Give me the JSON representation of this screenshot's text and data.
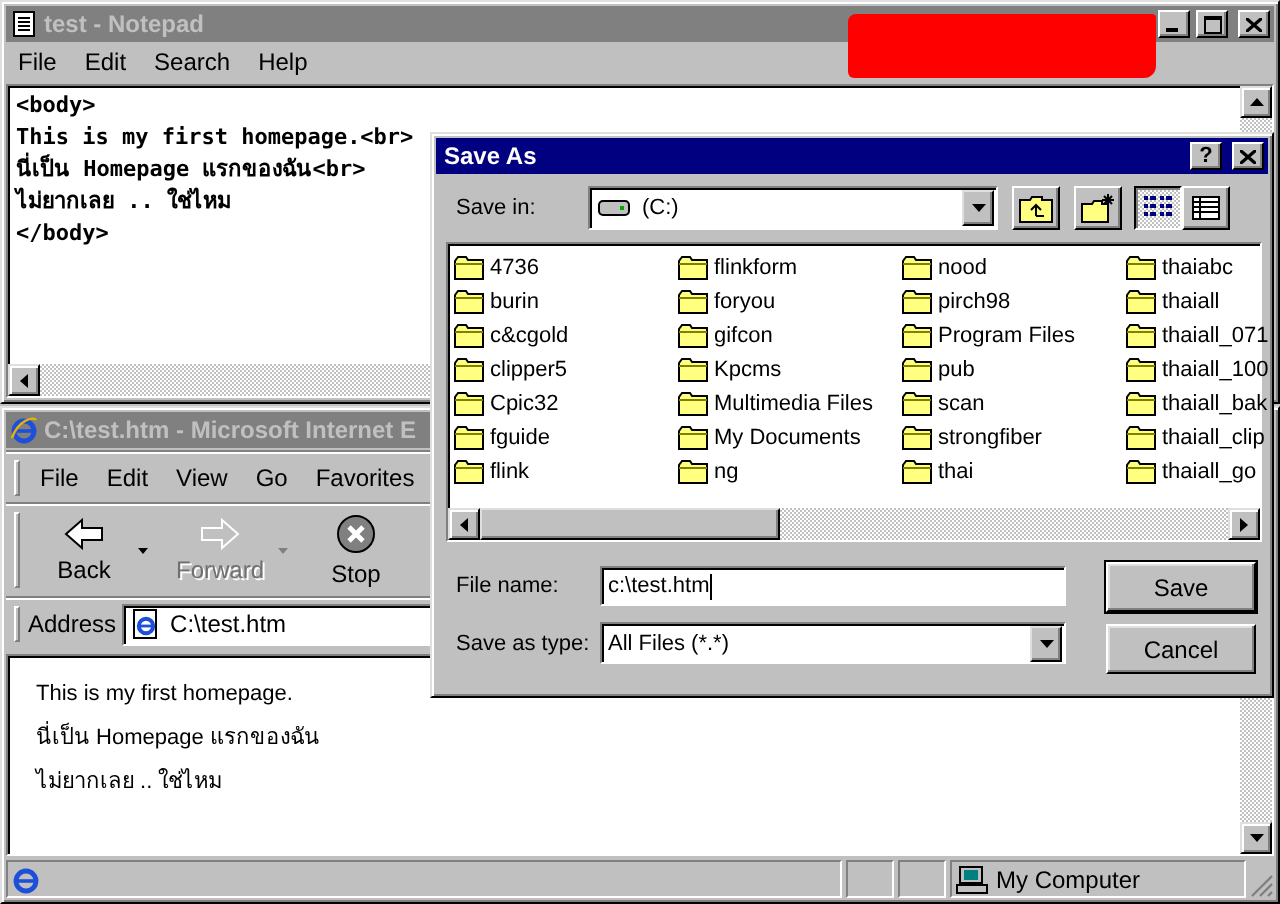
{
  "notepad": {
    "title": "test - Notepad",
    "active": false,
    "menu": [
      "File",
      "Edit",
      "Search",
      "Help"
    ],
    "lines": [
      "<body>",
      "This is my first homepage.<br>",
      "นี่เป็น Homepage แรกของฉัน<br>",
      "ไม่ยากเลย .. ใช่ไหม",
      "</body>"
    ]
  },
  "browser": {
    "title": "C:\\test.htm - Microsoft Internet E",
    "active": false,
    "menu": [
      "File",
      "Edit",
      "View",
      "Go",
      "Favorites"
    ],
    "toolbar": [
      {
        "kind": "back",
        "label": "Back",
        "disabled": false
      },
      {
        "kind": "forward",
        "label": "Forward",
        "disabled": true
      },
      {
        "kind": "stop",
        "label": "Stop",
        "disabled": false
      }
    ],
    "address_label": "Address",
    "address": "C:\\test.htm",
    "content": [
      "This is my first homepage.",
      "นี่เป็น Homepage แรกของฉัน",
      "ไม่ยากเลย .. ใช่ไหม"
    ],
    "status_zone": "My Computer"
  },
  "dialog": {
    "title": "Save As",
    "active": true,
    "help": "?",
    "save_in_label": "Save in:",
    "save_in": "(C:)",
    "views": [
      {
        "kind": "list",
        "selected": true
      },
      {
        "kind": "details",
        "selected": false
      }
    ],
    "folders": [
      {
        "name": "4736",
        "selected": false
      },
      {
        "name": "burin",
        "selected": false
      },
      {
        "name": "c&cgold",
        "selected": false
      },
      {
        "name": "clipper5",
        "selected": false
      },
      {
        "name": "Cpic32",
        "selected": false
      },
      {
        "name": "fguide",
        "selected": false
      },
      {
        "name": "flink",
        "selected": false
      },
      {
        "name": "flinkform",
        "selected": false
      },
      {
        "name": "foryou",
        "selected": false
      },
      {
        "name": "gifcon",
        "selected": false
      },
      {
        "name": "Kpcms",
        "selected": false
      },
      {
        "name": "Multimedia Files",
        "selected": false
      },
      {
        "name": "My Documents",
        "selected": false
      },
      {
        "name": "ng",
        "selected": false
      },
      {
        "name": "nood",
        "selected": false
      },
      {
        "name": "pirch98",
        "selected": false
      },
      {
        "name": "Program Files",
        "selected": false
      },
      {
        "name": "pub",
        "selected": false
      },
      {
        "name": "scan",
        "selected": false
      },
      {
        "name": "strongfiber",
        "selected": false
      },
      {
        "name": "thai",
        "selected": false
      },
      {
        "name": "thaiabc",
        "selected": false
      },
      {
        "name": "thaiall",
        "selected": false
      },
      {
        "name": "thaiall_071",
        "selected": false
      },
      {
        "name": "thaiall_100",
        "selected": false
      },
      {
        "name": "thaiall_bak",
        "selected": false
      },
      {
        "name": "thaiall_clip",
        "selected": false
      },
      {
        "name": "thaiall_go",
        "selected": false
      }
    ],
    "file_name_label": "File name:",
    "file_name": "c:\\test.htm",
    "type_label": "Save as type:",
    "type": "All Files (*.*)",
    "buttons": [
      "Save",
      "Cancel"
    ]
  }
}
